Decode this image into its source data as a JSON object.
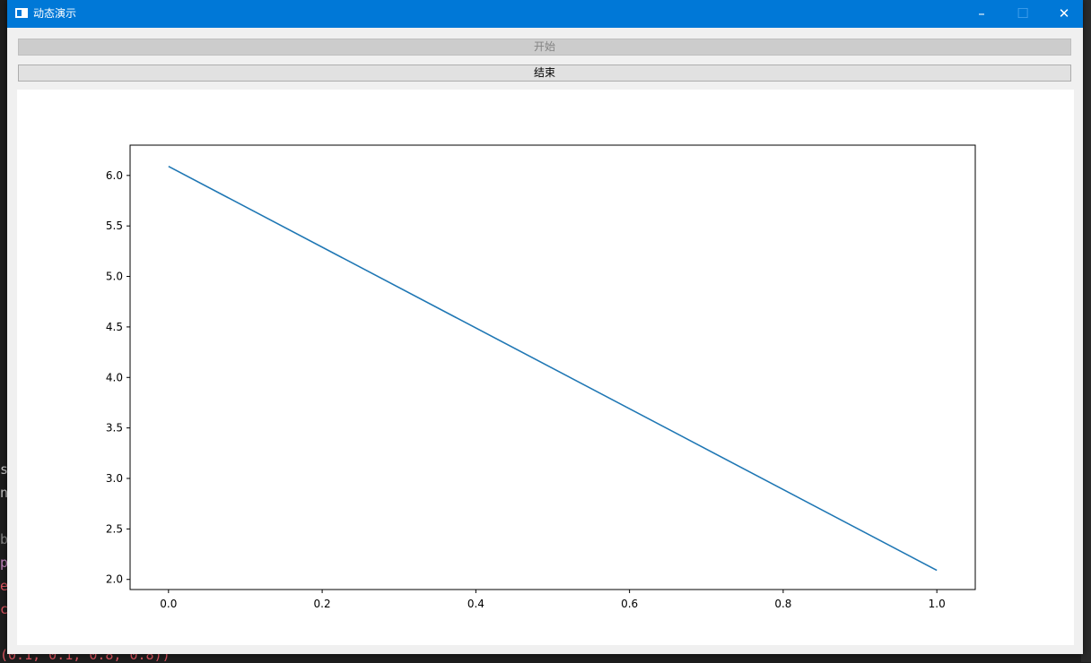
{
  "window": {
    "title": "动态演示",
    "minimize_glyph": "–",
    "maximize_glyph": "☐",
    "close_glyph": "✕"
  },
  "buttons": {
    "start_label": "开始",
    "end_label": "结束"
  },
  "background": {
    "fragments": [
      "s",
      "n",
      "b",
      "p",
      "e",
      "c"
    ],
    "bottom_line": "(0.1, 0.1, 0.8, 0.8))"
  },
  "colors": {
    "titlebar": "#0078d7",
    "line": "#1f77b4"
  },
  "chart_data": {
    "type": "line",
    "title": "",
    "xlabel": "",
    "ylabel": "",
    "xlim": [
      -0.05,
      1.05
    ],
    "ylim": [
      1.9,
      6.3
    ],
    "xticks": [
      0.0,
      0.2,
      0.4,
      0.6,
      0.8,
      1.0
    ],
    "xtick_labels": [
      "0.0",
      "0.2",
      "0.4",
      "0.6",
      "0.8",
      "1.0"
    ],
    "yticks": [
      2.0,
      2.5,
      3.0,
      3.5,
      4.0,
      4.5,
      5.0,
      5.5,
      6.0
    ],
    "ytick_labels": [
      "2.0",
      "2.5",
      "3.0",
      "3.5",
      "4.0",
      "4.5",
      "5.0",
      "5.5",
      "6.0"
    ],
    "grid": false,
    "series": [
      {
        "x": [
          0.0,
          1.0
        ],
        "y": [
          6.09,
          2.09
        ]
      }
    ]
  }
}
